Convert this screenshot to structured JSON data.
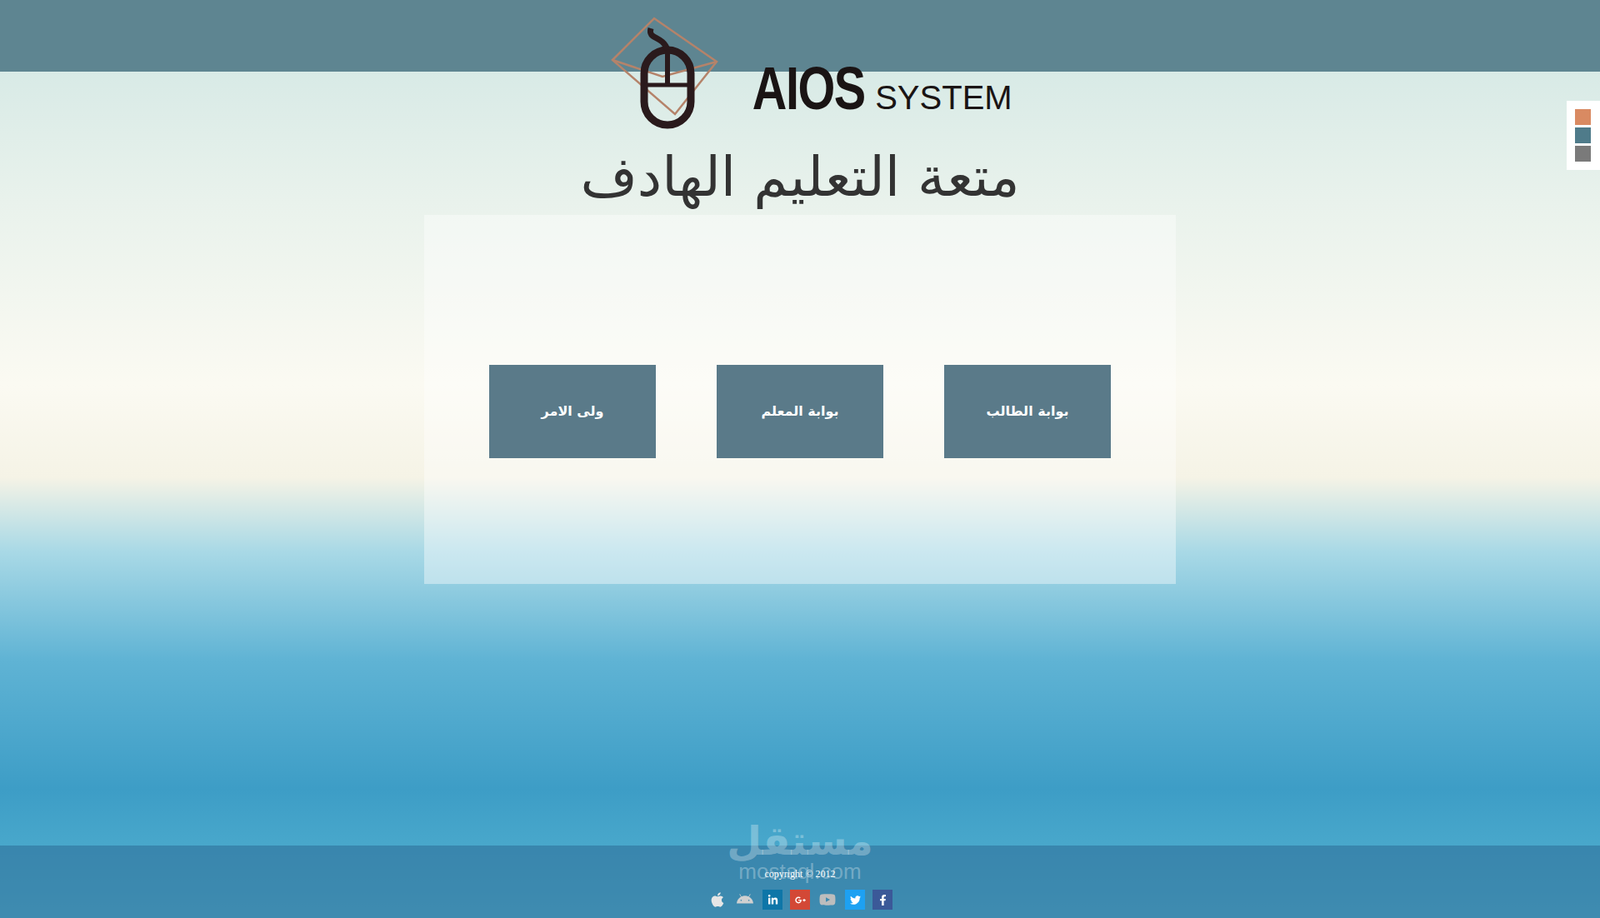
{
  "header": {
    "logo": {
      "primary": "AIOS",
      "secondary": "SYSTEM"
    }
  },
  "headline": "متعة التعليم الهادف",
  "portals": [
    {
      "label": "بوابة الطالب"
    },
    {
      "label": "بوابة المعلم"
    },
    {
      "label": "ولى الامر"
    }
  ],
  "theme_switcher": [
    {
      "color": "#d98a62"
    },
    {
      "color": "#4f7b8a"
    },
    {
      "color": "#7a7a7a"
    }
  ],
  "footer": {
    "copyright": "copyright © 2012",
    "social": [
      {
        "kind": "apple",
        "color": "#e6e6e6"
      },
      {
        "kind": "android",
        "color": "#d0d0d0"
      },
      {
        "kind": "linkedin",
        "color": "#0e76a8"
      },
      {
        "kind": "googleplus",
        "color": "#d34836"
      },
      {
        "kind": "youtube",
        "color": "#bdbdbd"
      },
      {
        "kind": "twitter",
        "color": "#1da1f2"
      },
      {
        "kind": "facebook",
        "color": "#3b5998"
      }
    ]
  },
  "watermark": {
    "arabic": "مستقل",
    "latin": "mostaql.com"
  }
}
